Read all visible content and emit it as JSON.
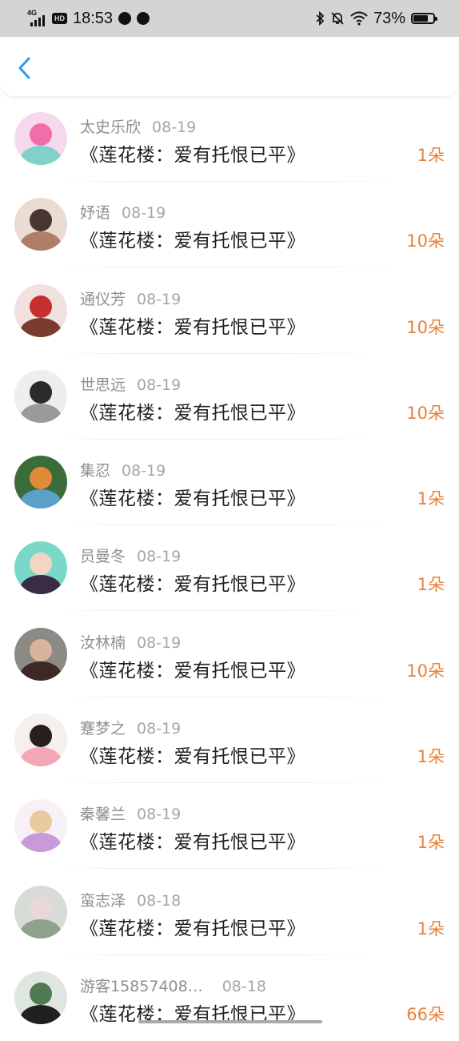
{
  "status_bar": {
    "time": "18:53",
    "network": "4G",
    "hd": "HD",
    "battery": "73%",
    "battery_level": 0.73
  },
  "header": {
    "back_icon": "chevron-left-icon"
  },
  "colors": {
    "accent": "#2e9bf0",
    "amount": "#e8823a",
    "name": "#8f8f8f"
  },
  "items": [
    {
      "name": "太史乐欣",
      "date": "08-19",
      "title": "《莲花楼：爱有托恨已平》",
      "amount": "1朵",
      "avatar_colors": [
        "#f7d9ee",
        "#7fd1c9",
        "#f26ea8"
      ]
    },
    {
      "name": "妤语",
      "date": "08-19",
      "title": "《莲花楼：爱有托恨已平》",
      "amount": "10朵",
      "avatar_colors": [
        "#e9dcd3",
        "#b07e68",
        "#4c3530"
      ]
    },
    {
      "name": "通仪芳",
      "date": "08-19",
      "title": "《莲花楼：爱有托恨已平》",
      "amount": "10朵",
      "avatar_colors": [
        "#f1e2df",
        "#7a3b2e",
        "#c72f2f"
      ]
    },
    {
      "name": "世思远",
      "date": "08-19",
      "title": "《莲花楼：爱有托恨已平》",
      "amount": "10朵",
      "avatar_colors": [
        "#eeeeee",
        "#9a9a9a",
        "#2b2b2b"
      ]
    },
    {
      "name": "集忍",
      "date": "08-19",
      "title": "《莲花楼：爱有托恨已平》",
      "amount": "1朵",
      "avatar_colors": [
        "#3b6d3a",
        "#5aa0c8",
        "#e08a3a"
      ]
    },
    {
      "name": "员曼冬",
      "date": "08-19",
      "title": "《莲花楼：爱有托恨已平》",
      "amount": "1朵",
      "avatar_colors": [
        "#7ad8c8",
        "#3a2c44",
        "#f3d5c2"
      ]
    },
    {
      "name": "汝林楠",
      "date": "08-19",
      "title": "《莲花楼：爱有托恨已平》",
      "amount": "10朵",
      "avatar_colors": [
        "#8c8a84",
        "#3d2a24",
        "#d8b49a"
      ]
    },
    {
      "name": "蹇梦之",
      "date": "08-19",
      "title": "《莲花楼：爱有托恨已平》",
      "amount": "1朵",
      "avatar_colors": [
        "#f5f0ec",
        "#f2a6b6",
        "#2a1d1d"
      ]
    },
    {
      "name": "秦馨兰",
      "date": "08-19",
      "title": "《莲花楼：爱有托恨已平》",
      "amount": "1朵",
      "avatar_colors": [
        "#f7f0f7",
        "#c89ad8",
        "#e9c99e"
      ]
    },
    {
      "name": "蛮志泽",
      "date": "08-18",
      "title": "《莲花楼：爱有托恨已平》",
      "amount": "1朵",
      "avatar_colors": [
        "#d8dcd6",
        "#8fa28c",
        "#e9d9d6"
      ]
    },
    {
      "name": "游客15857408…",
      "date": "08-18",
      "title": "《莲花楼：爱有托恨已平》",
      "amount": "66朵",
      "avatar_colors": [
        "#dfe6e0",
        "#202020",
        "#4f7a52"
      ]
    }
  ]
}
